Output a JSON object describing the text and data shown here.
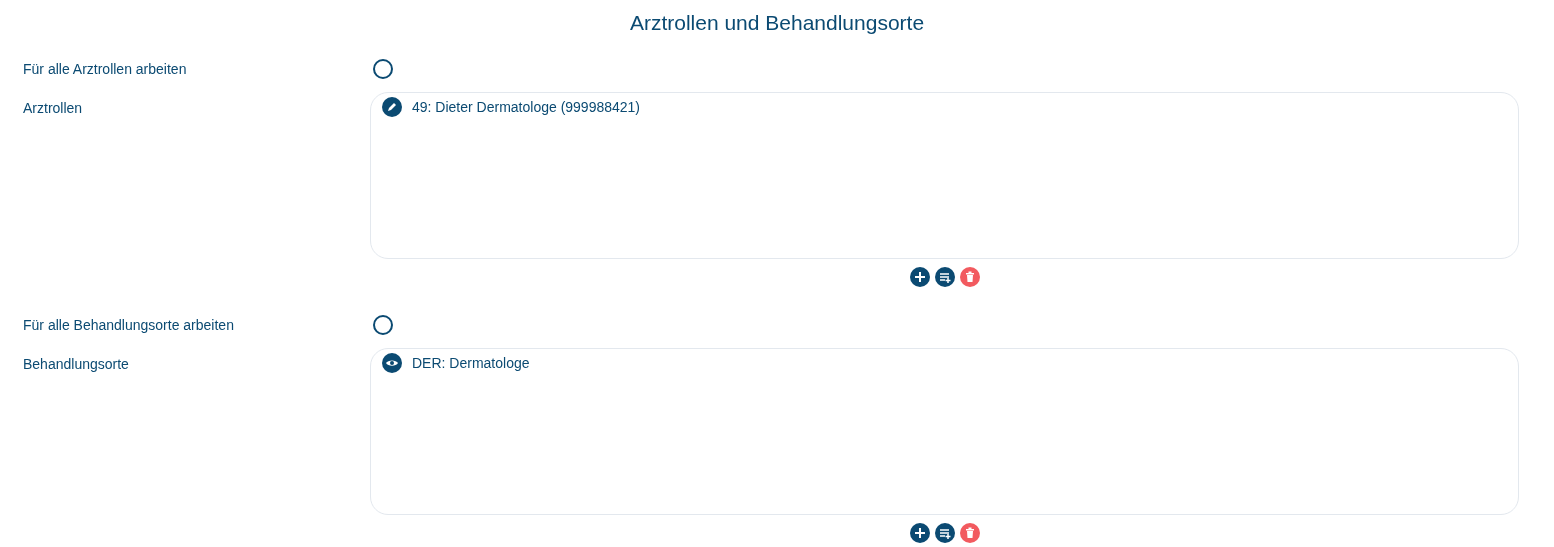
{
  "title": "Arztrollen und Behandlungsorte",
  "sections": [
    {
      "toggle_label": "Für alle Arztrollen arbeiten",
      "toggle_on": false,
      "list_label": "Arztrollen",
      "items": [
        {
          "kind": "edit",
          "text": "49: Dieter Dermatologe (999988421)"
        }
      ]
    },
    {
      "toggle_label": "Für alle Behandlungsorte arbeiten",
      "toggle_on": false,
      "list_label": "Behandlungsorte",
      "items": [
        {
          "kind": "view",
          "text": "DER: Dermatologe"
        }
      ]
    }
  ]
}
